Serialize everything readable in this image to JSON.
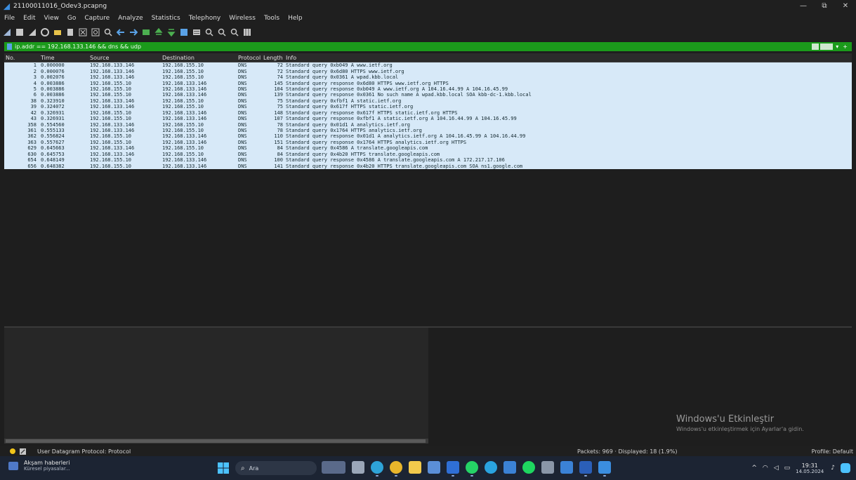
{
  "window": {
    "title": "21100011016_Odev3.pcapng",
    "minimize": "—",
    "restore": "⧉",
    "close": "✕"
  },
  "menu": [
    "File",
    "Edit",
    "View",
    "Go",
    "Capture",
    "Analyze",
    "Statistics",
    "Telephony",
    "Wireless",
    "Tools",
    "Help"
  ],
  "filter": {
    "value": "ip.addr == 192.168.133.146 && dns && udp",
    "plus": "+",
    "arrow": "▾"
  },
  "columns": {
    "no": "No.",
    "time": "Time",
    "source": "Source",
    "destination": "Destination",
    "protocol": "Protocol",
    "length": "Length",
    "info": "Info"
  },
  "packets": [
    {
      "no": "1",
      "time": "0.000000",
      "src": "192.168.133.146",
      "dst": "192.168.155.10",
      "proto": "DNS",
      "len": "72",
      "info": "Standard query 0xb049 A www.ietf.org"
    },
    {
      "no": "2",
      "time": "0.000076",
      "src": "192.168.133.146",
      "dst": "192.168.155.10",
      "proto": "DNS",
      "len": "72",
      "info": "Standard query 0x6d80 HTTPS www.ietf.org"
    },
    {
      "no": "3",
      "time": "0.002076",
      "src": "192.168.133.146",
      "dst": "192.168.155.10",
      "proto": "DNS",
      "len": "74",
      "info": "Standard query 0x0361 A wpad.kbb.local"
    },
    {
      "no": "4",
      "time": "0.003886",
      "src": "192.168.155.10",
      "dst": "192.168.133.146",
      "proto": "DNS",
      "len": "145",
      "info": "Standard query response 0x6d80 HTTPS www.ietf.org HTTPS"
    },
    {
      "no": "5",
      "time": "0.003886",
      "src": "192.168.155.10",
      "dst": "192.168.133.146",
      "proto": "DNS",
      "len": "104",
      "info": "Standard query response 0xb049 A www.ietf.org A 104.16.44.99 A 104.16.45.99"
    },
    {
      "no": "6",
      "time": "0.003886",
      "src": "192.168.155.10",
      "dst": "192.168.133.146",
      "proto": "DNS",
      "len": "139",
      "info": "Standard query response 0x0361 No such name A wpad.kbb.local SOA kbb-dc-1.kbb.local"
    },
    {
      "no": "38",
      "time": "0.323910",
      "src": "192.168.133.146",
      "dst": "192.168.155.10",
      "proto": "DNS",
      "len": "75",
      "info": "Standard query 0xfbf1 A static.ietf.org"
    },
    {
      "no": "39",
      "time": "0.324072",
      "src": "192.168.133.146",
      "dst": "192.168.155.10",
      "proto": "DNS",
      "len": "75",
      "info": "Standard query 0x617f HTTPS static.ietf.org"
    },
    {
      "no": "42",
      "time": "0.326931",
      "src": "192.168.155.10",
      "dst": "192.168.133.146",
      "proto": "DNS",
      "len": "148",
      "info": "Standard query response 0x617f HTTPS static.ietf.org HTTPS"
    },
    {
      "no": "43",
      "time": "0.326931",
      "src": "192.168.155.10",
      "dst": "192.168.133.146",
      "proto": "DNS",
      "len": "107",
      "info": "Standard query response 0xfbf1 A static.ietf.org A 104.16.44.99 A 104.16.45.99"
    },
    {
      "no": "358",
      "time": "0.554560",
      "src": "192.168.133.146",
      "dst": "192.168.155.10",
      "proto": "DNS",
      "len": "78",
      "info": "Standard query 0x01d1 A analytics.ietf.org"
    },
    {
      "no": "361",
      "time": "0.555133",
      "src": "192.168.133.146",
      "dst": "192.168.155.10",
      "proto": "DNS",
      "len": "78",
      "info": "Standard query 0x1764 HTTPS analytics.ietf.org"
    },
    {
      "no": "362",
      "time": "0.556824",
      "src": "192.168.155.10",
      "dst": "192.168.133.146",
      "proto": "DNS",
      "len": "110",
      "info": "Standard query response 0x01d1 A analytics.ietf.org A 104.16.45.99 A 104.16.44.99"
    },
    {
      "no": "363",
      "time": "0.557627",
      "src": "192.168.155.10",
      "dst": "192.168.133.146",
      "proto": "DNS",
      "len": "151",
      "info": "Standard query response 0x1764 HTTPS analytics.ietf.org HTTPS"
    },
    {
      "no": "629",
      "time": "0.645663",
      "src": "192.168.133.146",
      "dst": "192.168.155.10",
      "proto": "DNS",
      "len": "84",
      "info": "Standard query 0x4586 A translate.googleapis.com"
    },
    {
      "no": "630",
      "time": "0.645753",
      "src": "192.168.133.146",
      "dst": "192.168.155.10",
      "proto": "DNS",
      "len": "84",
      "info": "Standard query 0x4b20 HTTPS translate.googleapis.com"
    },
    {
      "no": "654",
      "time": "0.648149",
      "src": "192.168.155.10",
      "dst": "192.168.133.146",
      "proto": "DNS",
      "len": "100",
      "info": "Standard query response 0x4586 A translate.googleapis.com A 172.217.17.106"
    },
    {
      "no": "656",
      "time": "0.648382",
      "src": "192.168.155.10",
      "dst": "192.168.133.146",
      "proto": "DNS",
      "len": "141",
      "info": "Standard query response 0x4b20 HTTPS translate.googleapis.com SOA ns1.google.com"
    }
  ],
  "activation": {
    "title": "Windows'u Etkinleştir",
    "subtitle": "Windows'u etkinleştirmek için Ayarlar'a gidin."
  },
  "status": {
    "protocol": "User Datagram Protocol: Protocol",
    "counts": "Packets: 969 · Displayed: 18 (1.9%)",
    "profile": "Profile: Default"
  },
  "taskbar": {
    "news_title": "Akşam haberleri",
    "news_sub": "Küresel piyasalar...",
    "search_placeholder": "Ara",
    "time": "19:31",
    "date": "14.05.2024",
    "tray_chevron": "^"
  },
  "colors": {
    "row_bg": "#d7e9f8",
    "filter_bg": "#1b9a1b",
    "accent": "#3b82d6"
  }
}
